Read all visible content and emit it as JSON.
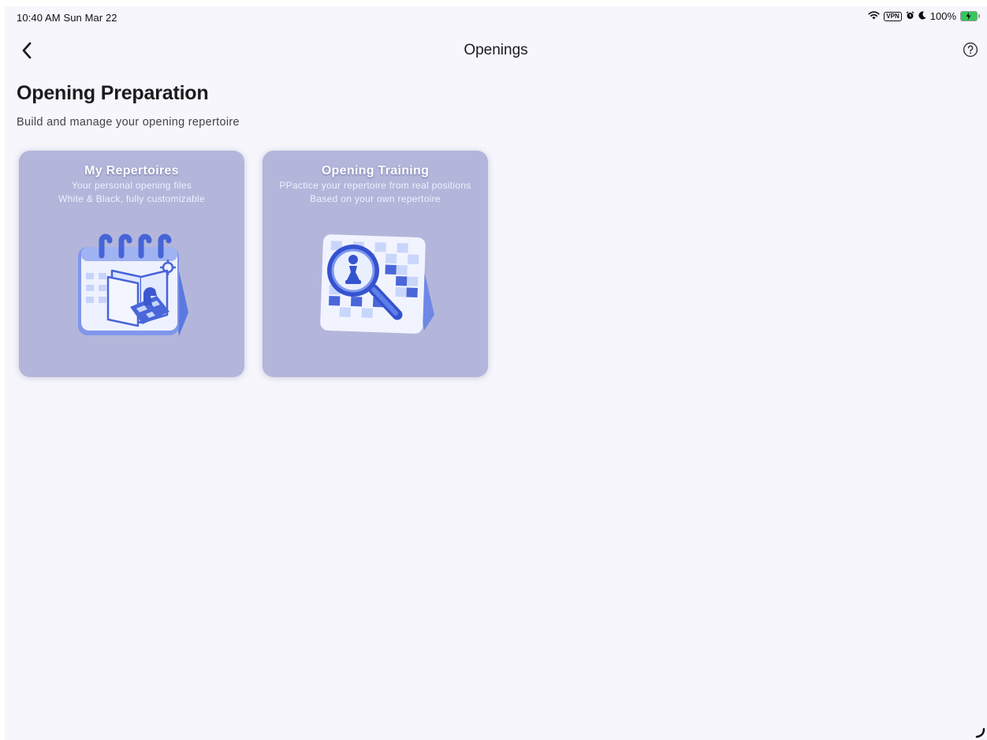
{
  "status_bar": {
    "time": "10:40 AM  Sun Mar 22",
    "vpn_label": "VPN",
    "battery_percent": "100%"
  },
  "nav": {
    "title": "Openings"
  },
  "header": {
    "title": "Opening Preparation",
    "subtitle": "Build and manage your opening repertoire"
  },
  "cards": [
    {
      "title": "My Repertoires",
      "line1": "Your personal opening files",
      "line2": "White & Black, fully customizable",
      "icon": "calendar-book-icon"
    },
    {
      "title": "Opening Training",
      "line1": "PPactice your repertoire from real positions",
      "line2": "Based on your own repertoire",
      "icon": "magnifier-pawn-icon"
    }
  ],
  "colors": {
    "background": "#f6f6fc",
    "card": "#b3b6da",
    "accent_blue": "#3d5fd6"
  }
}
